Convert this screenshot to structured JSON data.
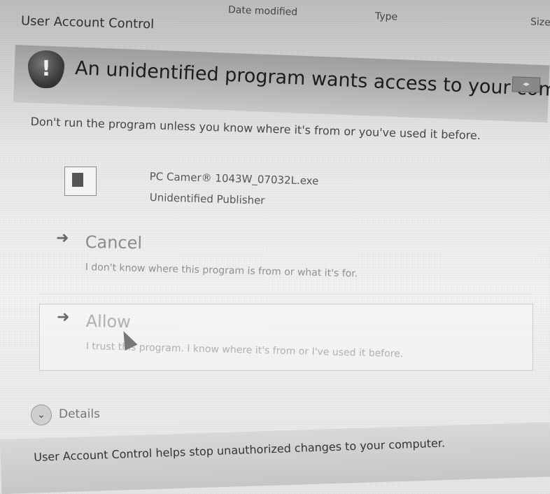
{
  "explorer_columns": {
    "date_modified": "Date modified",
    "type": "Type",
    "size": "Size"
  },
  "dialog": {
    "title": "User Account Control",
    "heading": "An unidentified program wants access to your computer",
    "intro": "Don't run the program unless you know where it's from or you've used it before.",
    "program": {
      "name": "PC Camer® 1043W_07032L.exe",
      "publisher": "Unidentified Publisher"
    },
    "options": [
      {
        "label": "Cancel",
        "description": "I don't know where this program is from or what it's for."
      },
      {
        "label": "Allow",
        "description": "I trust this program. I know where it's from or I've used it before."
      }
    ],
    "details_label": "Details",
    "footer": "User Account Control helps stop unauthorized changes to your computer."
  },
  "icons": {
    "shield": "shield-warning-icon",
    "arrow": "arrow-right-icon",
    "chevron": "chevron-down-icon"
  }
}
